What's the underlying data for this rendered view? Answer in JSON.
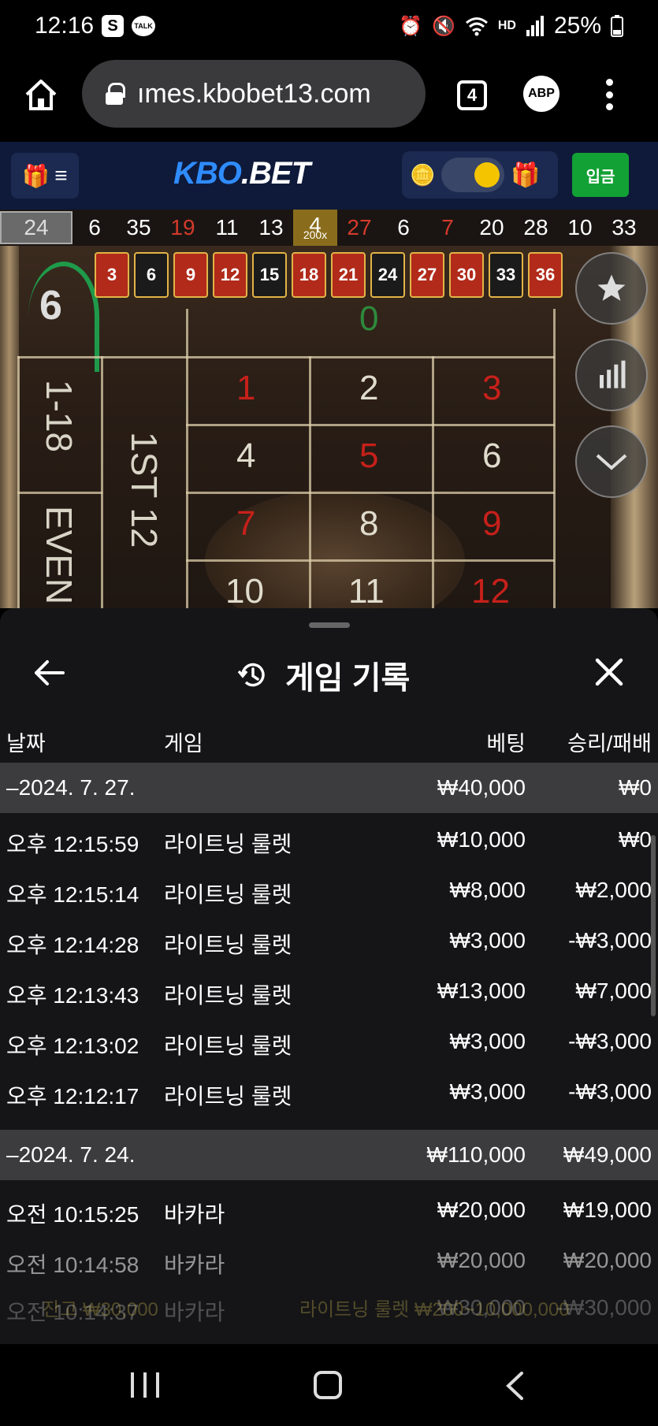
{
  "status_bar": {
    "time": "12:16",
    "app_badge": "S",
    "talk_badge": "TALK",
    "hd_label": "HD",
    "battery": "25%"
  },
  "browser": {
    "url": "ımes.kbobet13.com",
    "tab_count": "4",
    "adblock_label": "ABP"
  },
  "site": {
    "logo_part1": "KBO",
    "logo_part2": ".BET",
    "deposit_label": "입금"
  },
  "history_strip": {
    "first": "24",
    "numbers": [
      "6",
      "35",
      "19",
      "11",
      "13",
      "4",
      "27",
      "6",
      "7",
      "20",
      "28",
      "10",
      "33"
    ],
    "red": [
      false,
      false,
      true,
      false,
      false,
      false,
      true,
      false,
      true,
      false,
      false,
      false,
      false
    ],
    "gold_multiplier": "200x"
  },
  "game": {
    "winning_number": "6",
    "tiles": [
      "3",
      "6",
      "9",
      "12",
      "15",
      "18",
      "21",
      "24",
      "27",
      "30",
      "33",
      "36"
    ],
    "side_labels": [
      "1-18",
      "EVEN",
      "1ST 12"
    ]
  },
  "sheet": {
    "title": "게임 기록",
    "columns": {
      "date": "날짜",
      "game": "게임",
      "bet": "베팅",
      "result": "승리/패배"
    },
    "rows": [
      {
        "type": "date",
        "time": "–2024. 7. 27.",
        "game": "",
        "bet": "₩40,000",
        "result": "₩0"
      },
      {
        "type": "entry",
        "time": "오후 12:15:59",
        "game": "라이트닝 룰렛",
        "bet": "₩10,000",
        "result": "₩0"
      },
      {
        "type": "entry",
        "time": "오후 12:15:14",
        "game": "라이트닝 룰렛",
        "bet": "₩8,000",
        "result": "₩2,000"
      },
      {
        "type": "entry",
        "time": "오후 12:14:28",
        "game": "라이트닝 룰렛",
        "bet": "₩3,000",
        "result": "-₩3,000"
      },
      {
        "type": "entry",
        "time": "오후 12:13:43",
        "game": "라이트닝 룰렛",
        "bet": "₩13,000",
        "result": "₩7,000"
      },
      {
        "type": "entry",
        "time": "오후 12:13:02",
        "game": "라이트닝 룰렛",
        "bet": "₩3,000",
        "result": "-₩3,000"
      },
      {
        "type": "entry",
        "time": "오후 12:12:17",
        "game": "라이트닝 룰렛",
        "bet": "₩3,000",
        "result": "-₩3,000"
      },
      {
        "type": "date",
        "time": "–2024. 7. 24.",
        "game": "",
        "bet": "₩110,000",
        "result": "₩49,000"
      },
      {
        "type": "entry",
        "time": "오전 10:15:25",
        "game": "바카라",
        "bet": "₩20,000",
        "result": "₩19,000"
      },
      {
        "type": "entry",
        "time": "오전 10:14:58",
        "game": "바카라",
        "bet": "₩20,000",
        "result": "₩20,000"
      },
      {
        "type": "entry",
        "time": "오전 10:14:37",
        "game": "바카라",
        "bet": "₩30,000",
        "result": "-₩30,000"
      }
    ]
  },
  "footer": {
    "balance": "잔고 ₩30,000",
    "limits": "라이트닝 룰렛 ₩200~10,000,000"
  }
}
